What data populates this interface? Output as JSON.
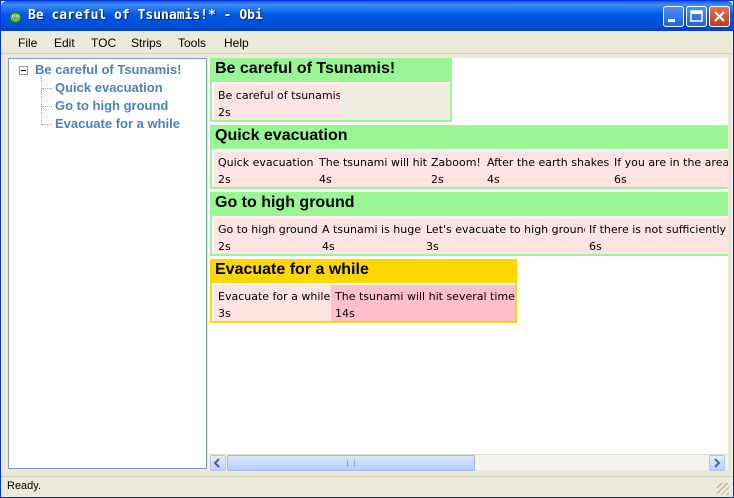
{
  "window": {
    "title": "Be careful of Tsunamis!* - Obi",
    "icon": "obi-app-icon"
  },
  "menu": [
    "File",
    "Edit",
    "TOC",
    "Strips",
    "Tools",
    "Help"
  ],
  "toc": {
    "root": "Be careful of Tsunamis!",
    "children": [
      "Quick evacuation",
      "Go to high ground",
      "Evacuate for a while"
    ]
  },
  "strips": [
    {
      "title": "Be careful of Tsunamis!",
      "blocks": [
        {
          "label": "Be careful of tsunamis",
          "duration": "2s"
        }
      ]
    },
    {
      "title": "Quick evacuation",
      "blocks": [
        {
          "label": "Quick evacuation",
          "duration": "2s"
        },
        {
          "label": "The tsunami will hit",
          "duration": "4s"
        },
        {
          "label": "Zaboom!",
          "duration": "2s"
        },
        {
          "label": "After the earth shakes",
          "duration": "4s"
        },
        {
          "label": "If you are in the area",
          "duration": "6s"
        }
      ]
    },
    {
      "title": "Go to high ground",
      "blocks": [
        {
          "label": "Go to high ground",
          "duration": "2s"
        },
        {
          "label": "A tsunami is huge",
          "duration": "4s"
        },
        {
          "label": "Let's evacuate to high ground",
          "duration": "3s"
        },
        {
          "label": "If there is not sufficiently h",
          "duration": "6s"
        }
      ]
    },
    {
      "title": "Evacuate for a while",
      "blocks": [
        {
          "label": "Evacuate for a while",
          "duration": "3s"
        },
        {
          "label": "The tsunami will hit several times",
          "duration": "14s"
        }
      ]
    }
  ],
  "scrollbar": {
    "left_icon": "scroll-left-arrow-icon",
    "right_icon": "scroll-right-arrow-icon"
  },
  "status": "Ready.",
  "colors": {
    "strip_header": "#9af594",
    "selected_strip": "#ffd700",
    "block": "#ffe4e1",
    "selected_block": "#ffc0cb",
    "toc_text": "#4f7fbf"
  }
}
